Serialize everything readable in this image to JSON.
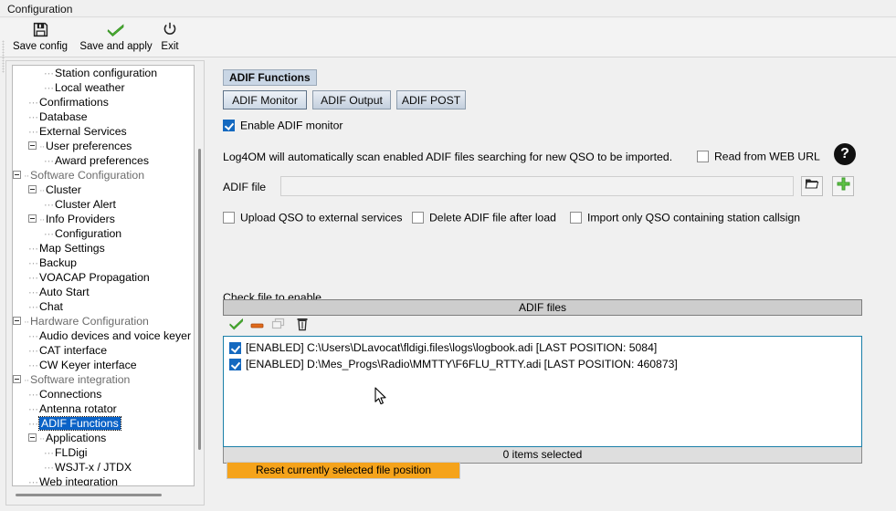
{
  "window": {
    "title": "Configuration"
  },
  "toolbar": {
    "items": [
      {
        "label": "Save config",
        "icon": "floppy-disk-icon"
      },
      {
        "label": "Save and apply",
        "icon": "green-check-icon"
      },
      {
        "label": "Exit",
        "icon": "power-icon"
      }
    ]
  },
  "sidebar": {
    "items": [
      {
        "label": "Station configuration",
        "depth": 3,
        "type": "leaf",
        "selected": false
      },
      {
        "label": "Local weather",
        "depth": 3,
        "type": "leaf",
        "selected": false
      },
      {
        "label": "Confirmations",
        "depth": 2,
        "type": "leaf",
        "selected": false
      },
      {
        "label": "Database",
        "depth": 2,
        "type": "leaf",
        "selected": false
      },
      {
        "label": "External Services",
        "depth": 2,
        "type": "leaf",
        "selected": false
      },
      {
        "label": "User preferences",
        "depth": 2,
        "type": "expanded",
        "selected": false
      },
      {
        "label": "Award preferences",
        "depth": 3,
        "type": "leaf",
        "selected": false
      },
      {
        "label": "Software Configuration",
        "depth": 1,
        "type": "expanded",
        "selected": false,
        "group": true
      },
      {
        "label": "Cluster",
        "depth": 2,
        "type": "expanded",
        "selected": false
      },
      {
        "label": "Cluster Alert",
        "depth": 3,
        "type": "leaf",
        "selected": false
      },
      {
        "label": "Info Providers",
        "depth": 2,
        "type": "expanded",
        "selected": false
      },
      {
        "label": "Configuration",
        "depth": 3,
        "type": "leaf",
        "selected": false
      },
      {
        "label": "Map Settings",
        "depth": 2,
        "type": "leaf",
        "selected": false
      },
      {
        "label": "Backup",
        "depth": 2,
        "type": "leaf",
        "selected": false
      },
      {
        "label": "VOACAP Propagation",
        "depth": 2,
        "type": "leaf",
        "selected": false
      },
      {
        "label": "Auto Start",
        "depth": 2,
        "type": "leaf",
        "selected": false
      },
      {
        "label": "Chat",
        "depth": 2,
        "type": "leaf",
        "selected": false
      },
      {
        "label": "Hardware Configuration",
        "depth": 1,
        "type": "expanded",
        "selected": false,
        "group": true
      },
      {
        "label": "Audio devices and voice keyer",
        "depth": 2,
        "type": "leaf",
        "selected": false
      },
      {
        "label": "CAT interface",
        "depth": 2,
        "type": "leaf",
        "selected": false
      },
      {
        "label": "CW Keyer interface",
        "depth": 2,
        "type": "leaf",
        "selected": false
      },
      {
        "label": "Software integration",
        "depth": 1,
        "type": "expanded",
        "selected": false,
        "group": true
      },
      {
        "label": "Connections",
        "depth": 2,
        "type": "leaf",
        "selected": false
      },
      {
        "label": "Antenna rotator",
        "depth": 2,
        "type": "leaf",
        "selected": false
      },
      {
        "label": "ADIF Functions",
        "depth": 2,
        "type": "leaf",
        "selected": true
      },
      {
        "label": "Applications",
        "depth": 2,
        "type": "expanded",
        "selected": false
      },
      {
        "label": "FLDigi",
        "depth": 3,
        "type": "leaf",
        "selected": false
      },
      {
        "label": "WSJT-x / JTDX",
        "depth": 3,
        "type": "leaf",
        "selected": false
      },
      {
        "label": "Web integration",
        "depth": 2,
        "type": "leaf",
        "selected": false
      }
    ]
  },
  "panel": {
    "header": "ADIF Functions",
    "tabs": [
      {
        "label": "ADIF Monitor",
        "active": true
      },
      {
        "label": "ADIF Output",
        "active": false
      },
      {
        "label": "ADIF POST",
        "active": false
      }
    ],
    "enable_monitor": {
      "label": "Enable ADIF monitor",
      "checked": true
    },
    "description": "Log4OM will automatically scan enabled ADIF files searching for new QSO to be imported.",
    "read_web_url": {
      "label": "Read from WEB URL",
      "checked": false
    },
    "help_glyph": "?",
    "adif_file": {
      "label": "ADIF file",
      "value": "",
      "placeholder": ""
    },
    "options": [
      {
        "label": "Upload QSO to external services",
        "checked": false
      },
      {
        "label": "Delete ADIF file after load",
        "checked": false
      },
      {
        "label": "Import only QSO containing station callsign",
        "checked": false
      }
    ],
    "check_label": "Check file to enable",
    "list": {
      "column_header": "ADIF files",
      "toolbar_icons": [
        {
          "name": "enable-check-icon",
          "enabled": true
        },
        {
          "name": "disable-minus-icon",
          "enabled": true
        },
        {
          "name": "duplicate-icon",
          "enabled": false
        },
        {
          "name": "trash-icon",
          "enabled": true
        }
      ],
      "rows": [
        {
          "checked": true,
          "text": "[ENABLED] C:\\Users\\DLavocat\\fldigi.files\\logs\\logbook.adi [LAST POSITION: 5084]"
        },
        {
          "checked": true,
          "text": "[ENABLED] D:\\Mes_Progs\\Radio\\MMTTY\\F6FLU_RTTY.adi [LAST POSITION: 460873]"
        }
      ],
      "status": "0 items selected"
    },
    "reset_button": "Reset currently selected file position"
  },
  "colors": {
    "selection_blue": "#0a62c7",
    "header_blue": "#c9d6e5",
    "accent_orange": "#f5a31b",
    "list_border": "#1a7fa8",
    "checkbox_blue": "#1469c0",
    "icon_green": "#3fa535"
  }
}
